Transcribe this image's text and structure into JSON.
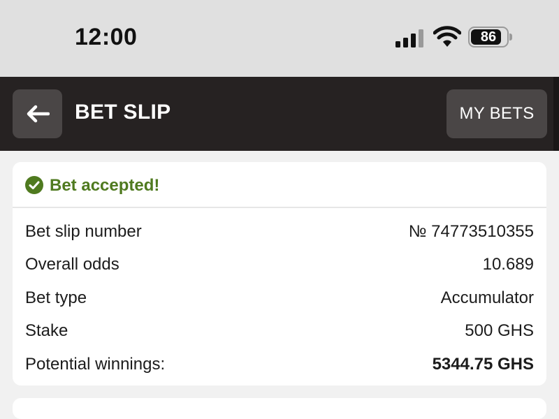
{
  "status_bar": {
    "time": "12:00",
    "battery": "86",
    "battery_fraction": 0.86
  },
  "header": {
    "title": "BET SLIP",
    "my_bets_label": "MY BETS",
    "background": "#262222"
  },
  "confirmation": {
    "message": "Bet accepted!",
    "accent": "#4f7a1f"
  },
  "details": {
    "bet_slip_number": {
      "label": "Bet slip number",
      "value": "№ 74773510355"
    },
    "overall_odds": {
      "label": "Overall odds",
      "value": "10.689"
    },
    "bet_type": {
      "label": "Bet type",
      "value": "Accumulator"
    },
    "stake": {
      "label": "Stake",
      "value": "500 GHS"
    },
    "potential_winnings": {
      "label": "Potential winnings:",
      "value": "5344.75 GHS"
    }
  },
  "icons": [
    "signal-icon",
    "wifi-icon",
    "battery-icon",
    "back-arrow-icon",
    "check-circle-icon"
  ]
}
